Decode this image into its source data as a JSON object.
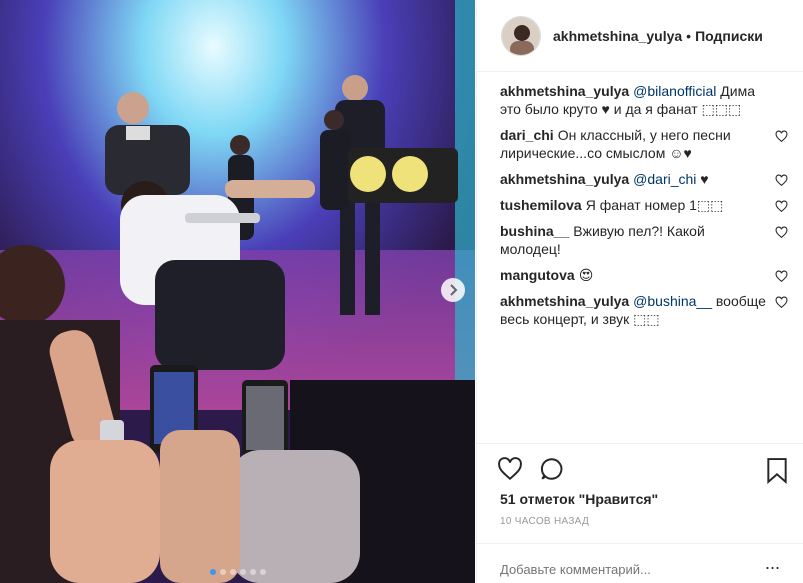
{
  "post": {
    "author": "akhmetshina_yulya",
    "separator": "•",
    "follow_label": "Подписки",
    "likes_text": "51 отметок \"Нравится\"",
    "timestamp": "10 ЧАСОВ НАЗАД",
    "add_comment_placeholder": "Добавьте комментарий...",
    "more_label": "...",
    "photo_count": 6,
    "active_photo": 1
  },
  "comments": [
    {
      "user": "akhmetshina_yulya",
      "mention": "@bilanofficial",
      "text": " Дима это было круто ♥ и да я фанат ⬚⬚⬚",
      "likeable": false
    },
    {
      "user": "dari_chi",
      "mention": "",
      "text": "Он классный, у него песни лирические...со смыслом ☺♥",
      "likeable": true
    },
    {
      "user": "akhmetshina_yulya",
      "mention": "@dari_chi",
      "text": " ♥",
      "likeable": true
    },
    {
      "user": "tushemilova",
      "mention": "",
      "text": "Я фанат номер 1⬚⬚",
      "likeable": true
    },
    {
      "user": "bushina__",
      "mention": "",
      "text": "Вживую пел?! Какой молодец!",
      "likeable": true
    },
    {
      "user": "mangutova",
      "mention": "",
      "text": "😍",
      "likeable": true
    },
    {
      "user": "akhmetshina_yulya",
      "mention": "@bushina__",
      "text": " вообще весь концерт, и звук ⬚⬚",
      "likeable": true
    }
  ],
  "icons": {
    "like": "heart-icon",
    "comment": "comment-bubble-icon",
    "save": "bookmark-icon",
    "next": "chevron-right-icon"
  },
  "colors": {
    "mention": "#003569",
    "timestamp": "#999999",
    "border": "#efefef",
    "active_dot": "#3897f0"
  }
}
